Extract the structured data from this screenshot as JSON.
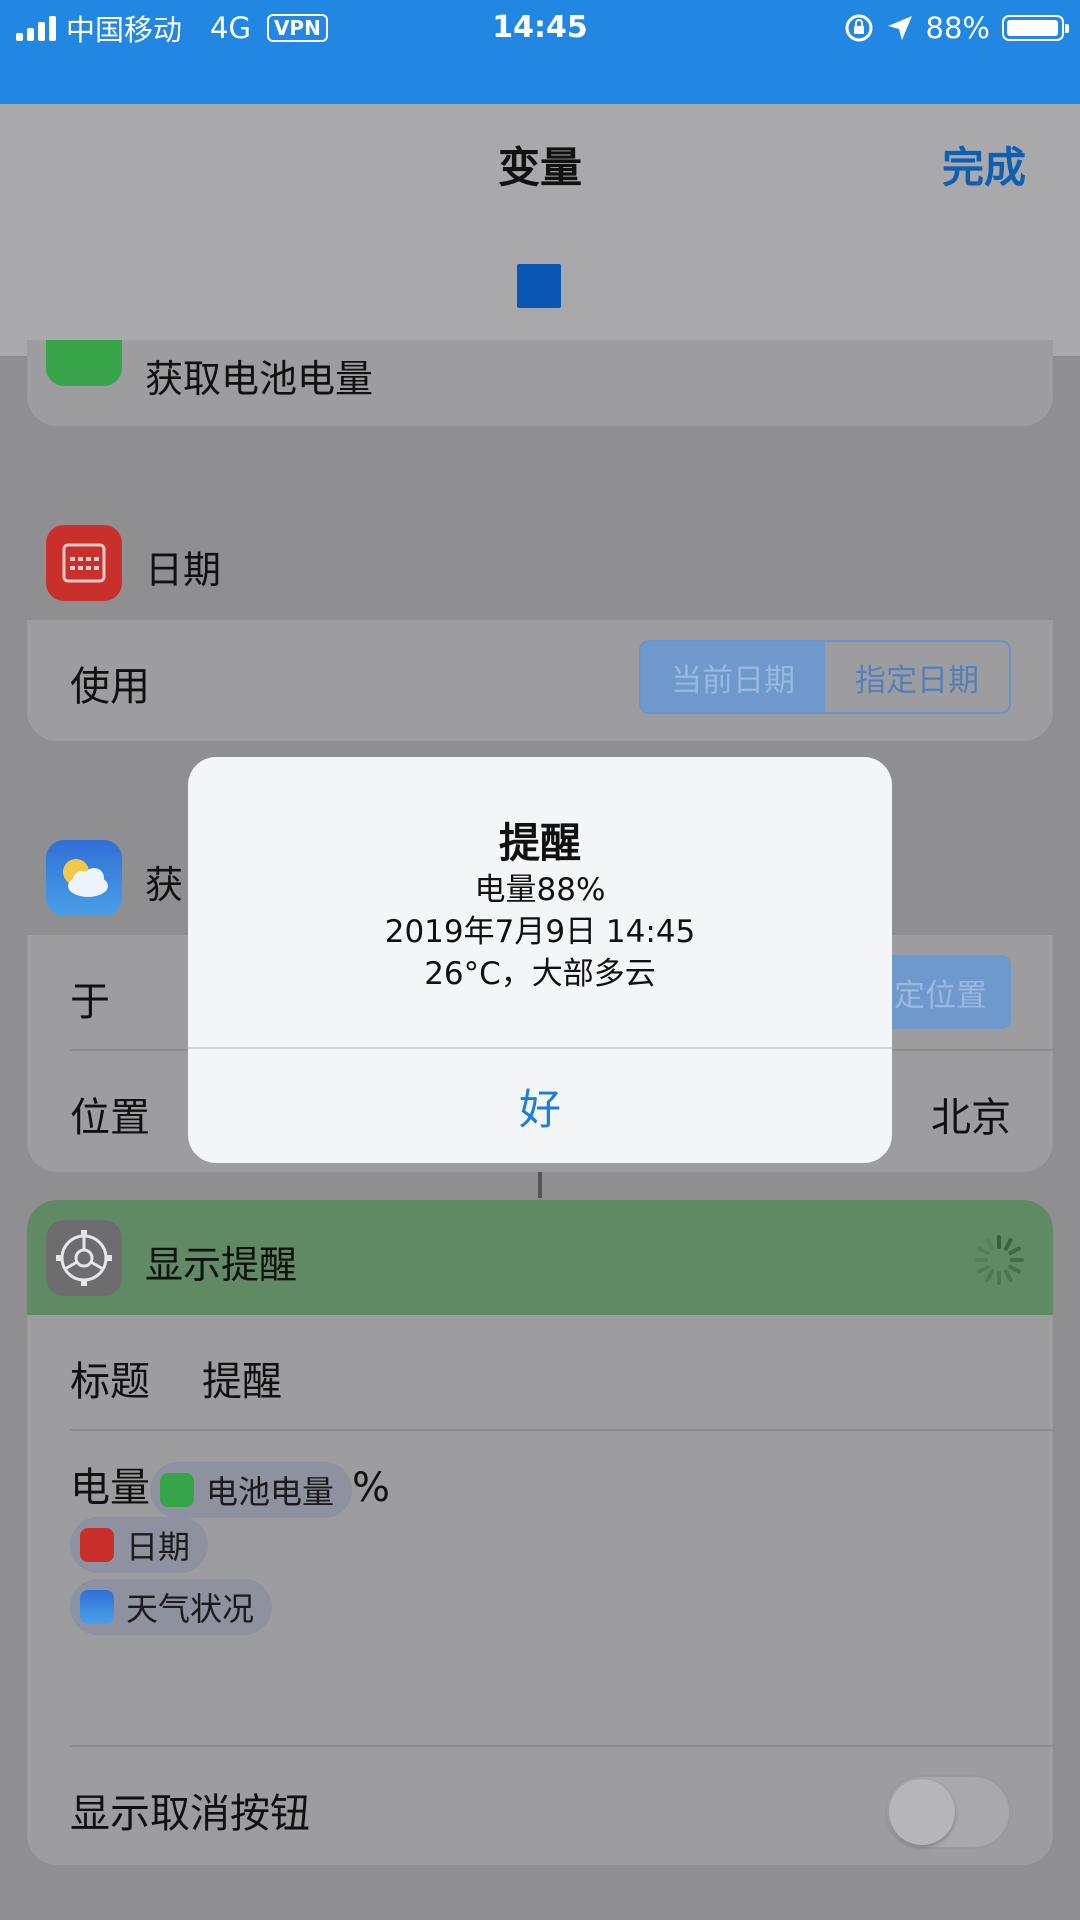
{
  "status_bar": {
    "carrier": "中国移动",
    "network": "4G",
    "vpn": "VPN",
    "time": "14:45",
    "battery_percent": "88%",
    "battery_level": 0.88
  },
  "nav": {
    "title": "变量",
    "done": "完成"
  },
  "card_battery": {
    "title": "获取电池电量"
  },
  "card_date": {
    "title": "日期",
    "row_label": "使用",
    "segments": [
      "当前日期",
      "指定日期"
    ],
    "selected": "当前日期"
  },
  "card_weather": {
    "title": "获",
    "row1_label": "于",
    "row1_button": "定位置",
    "row2_label": "位置",
    "row2_value": "北京"
  },
  "card_alert": {
    "title": "显示提醒",
    "title_label": "标题",
    "title_value": "提醒",
    "body_prefix": "电量",
    "token_battery": "电池电量",
    "body_suffix": "%",
    "token_date": "日期",
    "token_weather": "天气状况",
    "cancel_label": "显示取消按钮",
    "cancel_on": false
  },
  "alert": {
    "title": "提醒",
    "lines": [
      "电量88%",
      "2019年7月9日 14:45",
      "26°C，大部多云"
    ],
    "ok": "好"
  },
  "colors": {
    "status_bar": "#2286e3",
    "accent_blue": "#1d7ddb",
    "battery_green": "#37a44a",
    "calendar_red": "#c9302c"
  }
}
